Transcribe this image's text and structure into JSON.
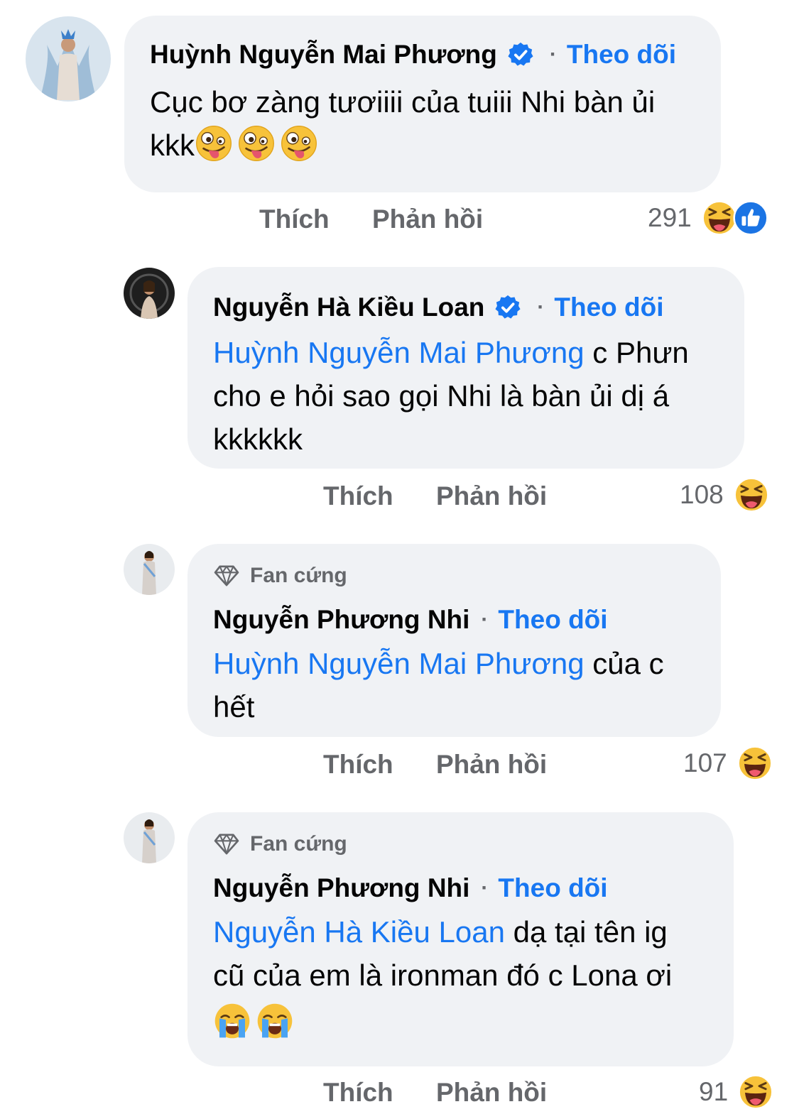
{
  "comments": [
    {
      "author": "Huỳnh Nguyễn Mai Phương",
      "verified": true,
      "follow": "Theo dõi",
      "text_lines": [
        "Cục bơ zàng tươiiii của tuiii Nhi bàn ủi",
        "kkk"
      ],
      "emojis": [
        "zany-face",
        "zany-face",
        "zany-face"
      ],
      "like_label": "Thích",
      "reply_label": "Phản hồi",
      "reaction_count": "291",
      "reactions": [
        "haha",
        "like"
      ]
    },
    {
      "author": "Nguyễn Hà Kiều Loan",
      "verified": true,
      "follow": "Theo dõi",
      "mention": "Huỳnh Nguyễn Mai Phương",
      "text_after_mention": " c Phưn",
      "text_lines": [
        "cho e hỏi sao gọi Nhi là bàn ủi dị á",
        "kkkkkk"
      ],
      "like_label": "Thích",
      "reply_label": "Phản hồi",
      "reaction_count": "108",
      "reactions": [
        "haha"
      ]
    },
    {
      "badge": "Fan cứng",
      "author": "Nguyễn Phương Nhi",
      "follow": "Theo dõi",
      "mention": "Huỳnh Nguyễn Mai Phương",
      "text_after_mention": " của c",
      "text_lines": [
        "hết"
      ],
      "like_label": "Thích",
      "reply_label": "Phản hồi",
      "reaction_count": "107",
      "reactions": [
        "haha"
      ]
    },
    {
      "badge": "Fan cứng",
      "author": "Nguyễn Phương Nhi",
      "follow": "Theo dõi",
      "mention": "Nguyễn Hà Kiều Loan",
      "text_after_mention": " dạ tại tên ig",
      "text_lines": [
        "cũ của em là ironman đó c Lona ơi"
      ],
      "emojis": [
        "loudly-crying-face",
        "loudly-crying-face"
      ],
      "like_label": "Thích",
      "reply_label": "Phản hồi",
      "reaction_count": "91",
      "reactions": [
        "haha"
      ]
    }
  ],
  "separator": "·",
  "colors": {
    "bubble": "#f0f2f5",
    "link": "#1877f2",
    "meta": "#65676b"
  }
}
